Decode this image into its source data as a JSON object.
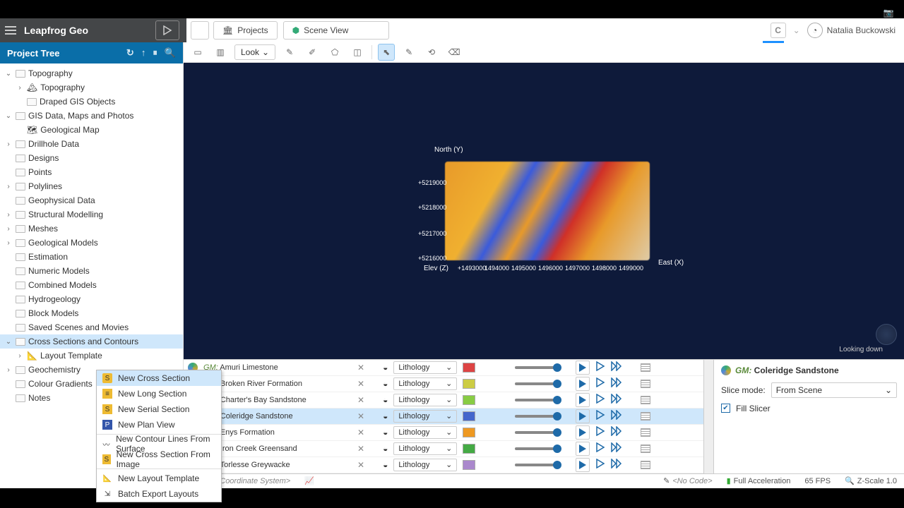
{
  "app": {
    "title": "Leapfrog Geo"
  },
  "tabs": {
    "projects": "Projects",
    "scene": "Scene View"
  },
  "user": {
    "name": "Natalia Buckowski"
  },
  "sidebar": {
    "title": "Project Tree",
    "items": [
      "Topography",
      "Topography",
      "Draped GIS Objects",
      "GIS Data, Maps and Photos",
      "Geological Map",
      "Drillhole Data",
      "Designs",
      "Points",
      "Polylines",
      "Geophysical Data",
      "Structural Modelling",
      "Meshes",
      "Geological Models",
      "Estimation",
      "Numeric Models",
      "Combined Models",
      "Hydrogeology",
      "Block Models",
      "Saved Scenes and Movies",
      "Cross Sections and Contours",
      "Layout Template",
      "Geochemistry",
      "Colour Gradients",
      "Notes"
    ]
  },
  "context": {
    "items": [
      "New Cross Section",
      "New Long Section",
      "New Serial Section",
      "New Plan View",
      "New Contour Lines From Surface",
      "New Cross Section From Image",
      "New Layout Template",
      "Batch Export Layouts"
    ]
  },
  "toolbar": {
    "look": "Look"
  },
  "viewport": {
    "north": "North (Y)",
    "east": "East (X)",
    "elev": "Elev (Z)",
    "yticks": [
      "+5219000",
      "+5218000",
      "+5217000",
      "+5216000"
    ],
    "xticks": [
      "+1493000",
      "1494000",
      "1495000",
      "1496000",
      "1497000",
      "1498000",
      "1499000"
    ],
    "looking": "Looking down"
  },
  "layers": [
    {
      "name": "Amuri Limestone",
      "color": "#d44"
    },
    {
      "name": "Broken River Formation",
      "color": "#cc4"
    },
    {
      "name": "Charter's Bay Sandstone",
      "color": "#8c4"
    },
    {
      "name": "Coleridge Sandstone",
      "color": "#46c"
    },
    {
      "name": "Enys Formation",
      "color": "#e92"
    },
    {
      "name": "Iron Creek Greensand",
      "color": "#4a4"
    },
    {
      "name": "Torlesse Greywacke",
      "color": "#a8c"
    }
  ],
  "layer_common": {
    "prefix": "GM:",
    "attr": "Lithology"
  },
  "props": {
    "title_prefix": "GM:",
    "title": "Coleridge Sandstone",
    "slice_label": "Slice mode:",
    "slice_value": "From Scene",
    "fill": "Fill Slicer"
  },
  "status": {
    "coord": "<No Coordinate System>",
    "code": "<No Code>",
    "accel": "Full Acceleration",
    "fps": "65 FPS",
    "zscale": "Z-Scale 1.0"
  }
}
